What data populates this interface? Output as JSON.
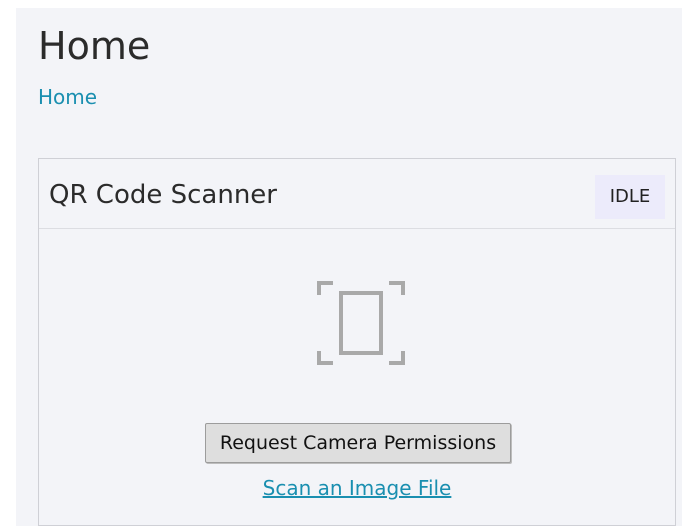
{
  "page": {
    "title": "Home",
    "breadcrumb": "Home"
  },
  "scanner": {
    "title": "QR Code Scanner",
    "status": "IDLE",
    "icon": "qr-scan-frame-icon",
    "request_button_label": "Request Camera Permissions",
    "scan_file_link_label": "Scan an Image File"
  },
  "colors": {
    "link": "#1a8fb0",
    "badge_bg": "#ecebfb",
    "page_bg": "#f3f4f8"
  }
}
